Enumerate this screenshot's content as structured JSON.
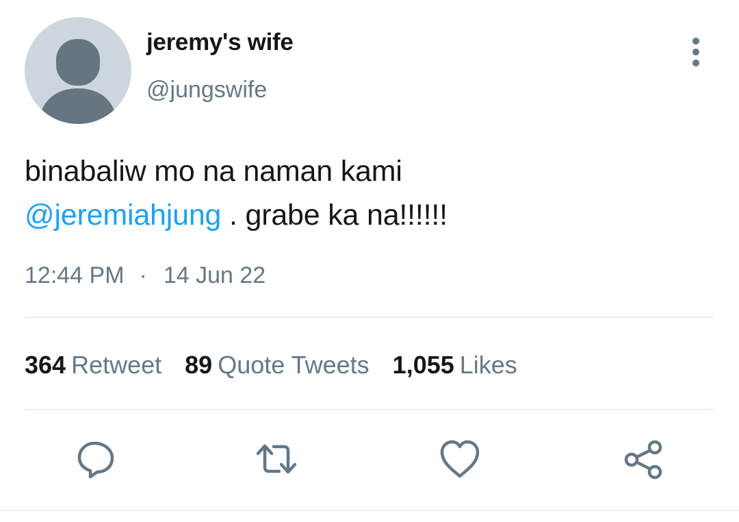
{
  "author": {
    "display_name": "jeremy's wife",
    "handle": "@jungswife"
  },
  "tweet": {
    "text_line1": "binabaliw mo na naman kami",
    "mention": "@jeremiahjung",
    "text_after_mention": " . grabe ka na!!!!!!",
    "time": "12:44 PM",
    "separator": "·",
    "date": "14 Jun 22"
  },
  "stats": {
    "retweets": {
      "count": "364",
      "label": "Retweet"
    },
    "quotes": {
      "count": "89",
      "label": "Quote Tweets"
    },
    "likes": {
      "count": "1,055",
      "label": "Likes"
    }
  },
  "icons": {
    "more": "more-vertical-icon",
    "reply": "reply-icon",
    "retweet": "retweet-icon",
    "like": "heart-icon",
    "share": "share-icon"
  },
  "colors": {
    "link": "#1da1f2",
    "secondary_text": "#657786",
    "primary_text": "#14171a",
    "divider": "#e6ecf0",
    "avatar_bg": "#ccd6dd",
    "avatar_fg": "#66757f"
  }
}
